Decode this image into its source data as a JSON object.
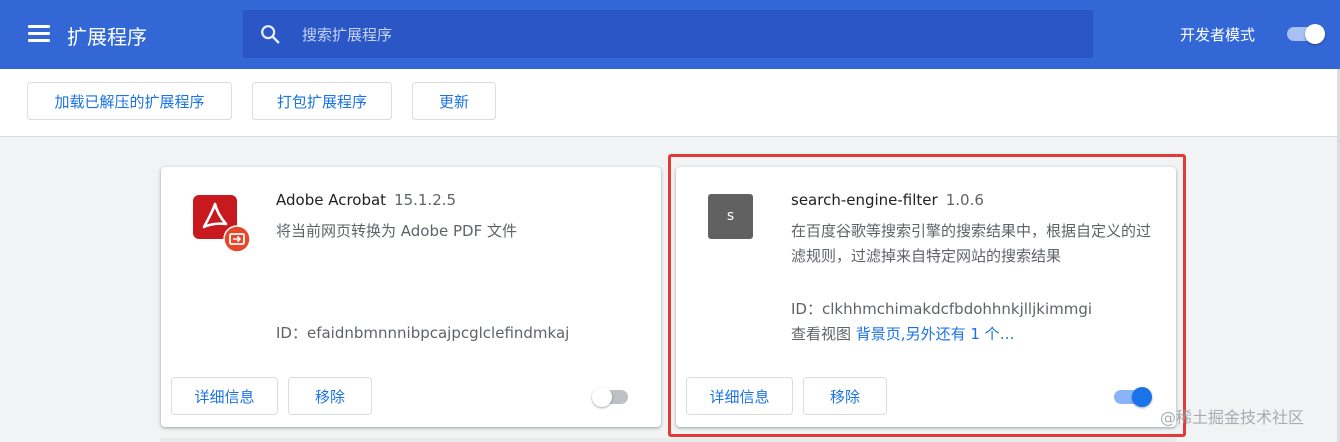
{
  "header": {
    "title": "扩展程序",
    "menu_icon": "hamburger-menu-icon",
    "search": {
      "placeholder": "搜索扩展程序",
      "value": ""
    },
    "dev_mode": {
      "label": "开发者模式",
      "enabled": true
    }
  },
  "toolbar": {
    "load_unpacked": "加载已解压的扩展程序",
    "pack": "打包扩展程序",
    "update": "更新"
  },
  "extensions": [
    {
      "name": "Adobe Acrobat",
      "version": "15.1.2.5",
      "description": "将当前网页转换为 Adobe PDF 文件",
      "id_label": "ID：",
      "id": "efaidnbmnnnibpcajpcglclefindmkaj",
      "icon": "adobe-acrobat-icon",
      "details_label": "详细信息",
      "remove_label": "移除",
      "enabled": false
    },
    {
      "name": "search-engine-filter",
      "version": "1.0.6",
      "description": "在百度谷歌等搜索引擎的搜索结果中，根据自定义的过滤规则，过滤掉来自特定网站的搜索结果",
      "id_label": "ID：",
      "id": "clkhhmchimakdcfbdohhnkjlljkimmgi",
      "views_label": "查看视图",
      "views_link": "背景页,另外还有 1 个…",
      "icon_letter": "s",
      "details_label": "详细信息",
      "remove_label": "移除",
      "enabled": true
    }
  ],
  "watermark": "@稀土掘金技术社区",
  "colors": {
    "header": "#3367d6",
    "accent": "#1a73e8",
    "highlight": "#e53935"
  }
}
